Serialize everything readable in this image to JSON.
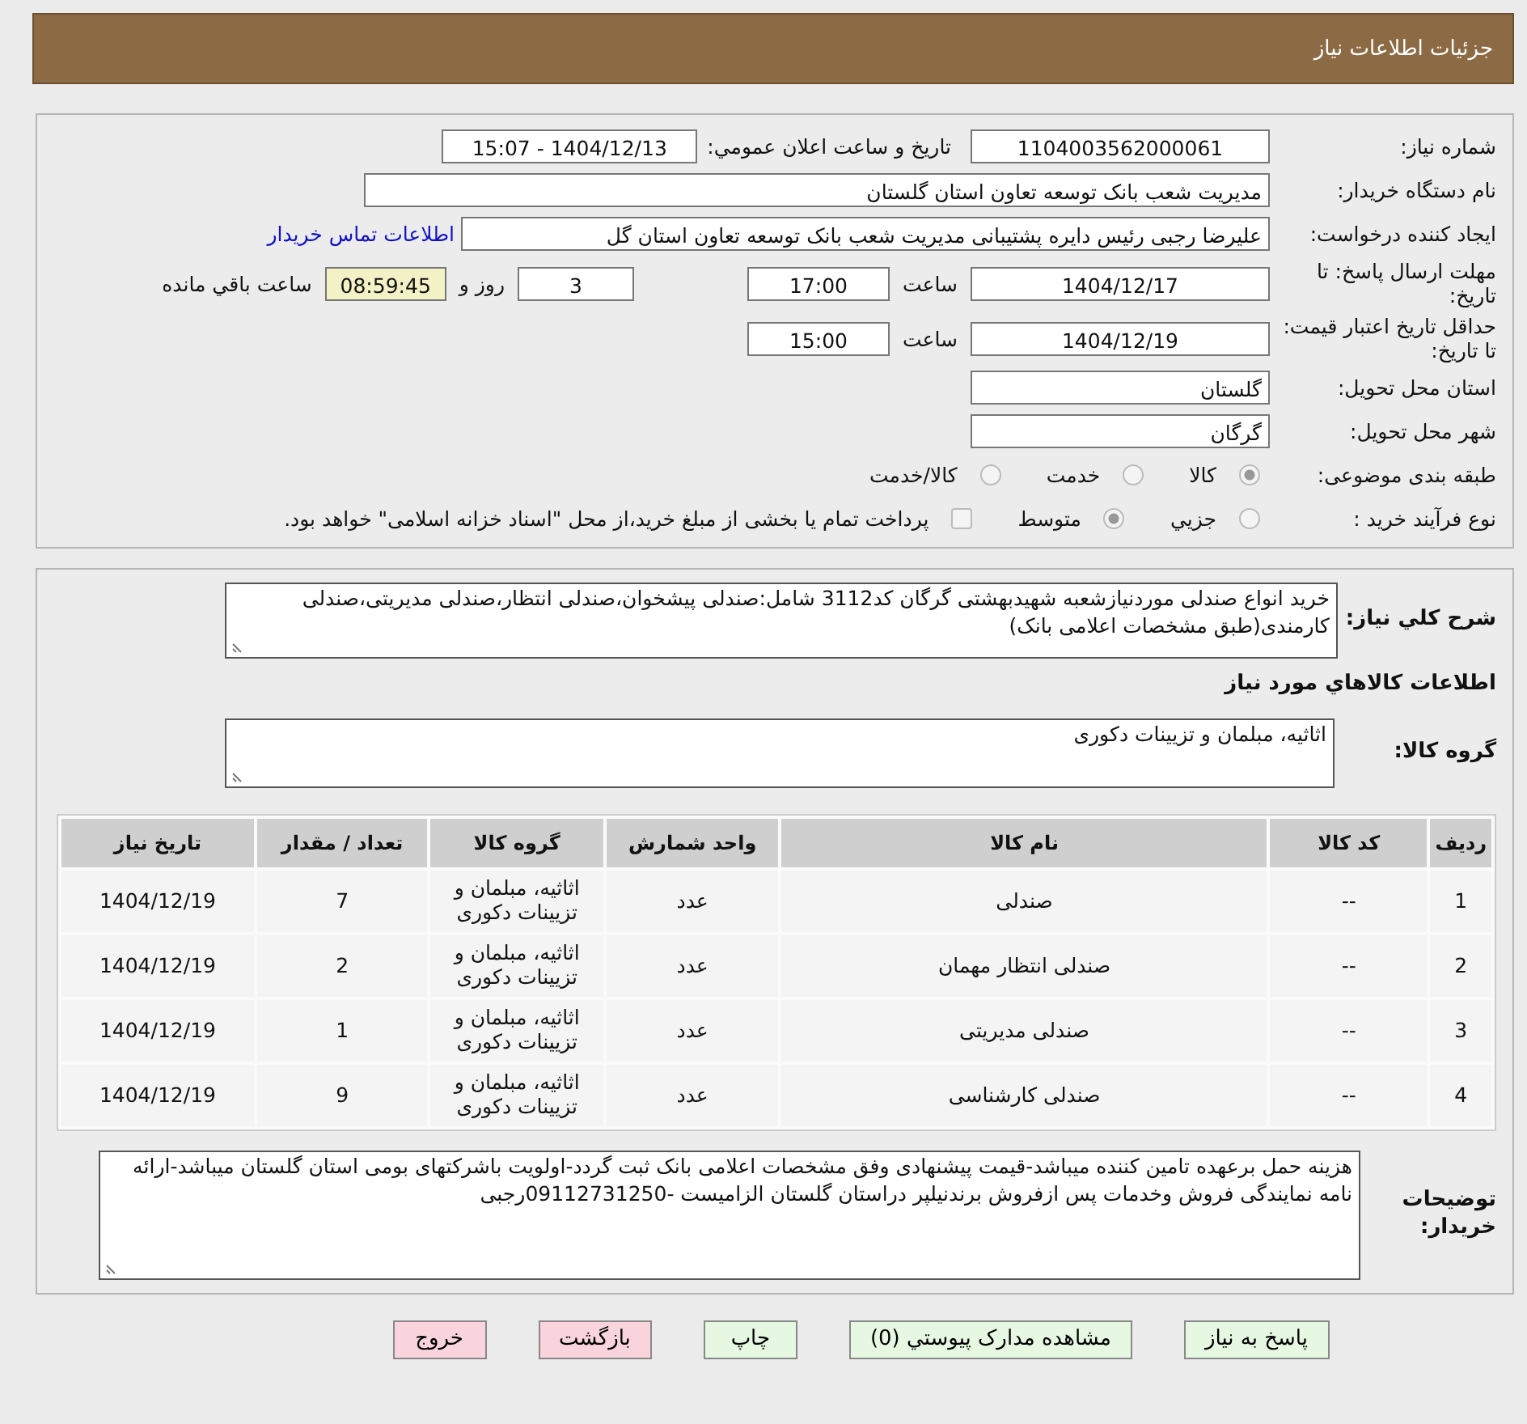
{
  "header": {
    "title": "جزئیات اطلاعات نیاز"
  },
  "form": {
    "need_number": {
      "label": "شماره نیاز:",
      "value": "1104003562000061"
    },
    "announce": {
      "label": "تاریخ و ساعت اعلان عمومي:",
      "value": "1404/12/13 - 15:07"
    },
    "buyer_org": {
      "label": "نام دستگاه خریدار:",
      "value": "مدیریت شعب بانک توسعه تعاون استان گلستان"
    },
    "requester": {
      "label": "ایجاد کننده درخواست:",
      "value": "علیرضا رجبی رئیس دایره پشتیبانی مدیریت شعب بانک توسعه تعاون استان گل",
      "link": "اطلاعات تماس خریدار"
    },
    "deadline": {
      "label": "مهلت ارسال پاسخ: تا تاریخ:",
      "date": "1404/12/17",
      "time_label": "ساعت",
      "time": "17:00",
      "days": "3",
      "days_label": "روز و",
      "remaining": "08:59:45",
      "remaining_label": "ساعت باقي مانده"
    },
    "validity": {
      "label": "حداقل تاریخ اعتبار قیمت: تا تاریخ:",
      "date": "1404/12/19",
      "time_label": "ساعت",
      "time": "15:00"
    },
    "province": {
      "label": "استان محل تحویل:",
      "value": "گلستان"
    },
    "city": {
      "label": "شهر محل تحویل:",
      "value": "گرگان"
    },
    "category": {
      "label": "طبقه بندی موضوعی:",
      "options": [
        {
          "label": "کالا",
          "selected": true
        },
        {
          "label": "خدمت",
          "selected": false
        },
        {
          "label": "کالا/خدمت",
          "selected": false
        }
      ]
    },
    "process": {
      "label": "نوع فرآیند خرید :",
      "options": [
        {
          "label": "جزيي",
          "selected": false
        },
        {
          "label": "متوسط",
          "selected": true
        }
      ],
      "treasury": {
        "checked": false,
        "label": "پرداخت تمام یا بخشی از مبلغ خرید،از محل \"اسناد خزانه اسلامی\" خواهد بود."
      }
    }
  },
  "details": {
    "description": {
      "label": "شرح کلي نیاز:",
      "value": "خرید  انواع صندلی  موردنیازشعبه شهیدبهشتی گرگان کد3112 شامل:صندلی پیشخوان،صندلی انتظار،صندلی مدیریتی،صندلی کارمندی(طبق مشخصات اعلامی بانک)"
    },
    "goods_heading": "اطلاعات کالاهاي مورد نیاز",
    "goods_group": {
      "label": "گروه کالا:",
      "value": "اثاثیه، مبلمان و تزیینات دکوری"
    },
    "table": {
      "columns": [
        "ردیف",
        "کد کالا",
        "نام کالا",
        "واحد شمارش",
        "گروه کالا",
        "تعداد / مقدار",
        "تاریخ نیاز"
      ],
      "rows": [
        [
          "1",
          "--",
          "صندلی",
          "عدد",
          "اثاثیه، مبلمان و تزیینات دکوری",
          "7",
          "1404/12/19"
        ],
        [
          "2",
          "--",
          "صندلی انتظار مهمان",
          "عدد",
          "اثاثیه، مبلمان و تزیینات دکوری",
          "2",
          "1404/12/19"
        ],
        [
          "3",
          "--",
          "صندلی مدیریتی",
          "عدد",
          "اثاثیه، مبلمان و تزیینات دکوری",
          "1",
          "1404/12/19"
        ],
        [
          "4",
          "--",
          "صندلی کارشناسی",
          "عدد",
          "اثاثیه، مبلمان و تزیینات دکوری",
          "9",
          "1404/12/19"
        ]
      ]
    },
    "buyer_notes": {
      "label": "توضیحات خریدار:",
      "value": "هزینه حمل برعهده تامین کننده میباشد-قیمت پیشنهادی وفق مشخصات اعلامی بانک ثبت گردد-اولویت باشرکتهای بومی استان گلستان میباشد-ارائه نامه نمایندگی فروش وخدمات پس ازفروش برندنیلپر  دراستان گلستان الزامیست -09112731250رجبی"
    }
  },
  "buttons": [
    {
      "label": "پاسخ به نیاز",
      "kind": "green"
    },
    {
      "label": "مشاهده مدارک پیوستي (0)",
      "kind": "green"
    },
    {
      "label": "چاپ",
      "kind": "green"
    },
    {
      "label": "بازگشت",
      "kind": "red"
    },
    {
      "label": "خروج",
      "kind": "red"
    }
  ]
}
